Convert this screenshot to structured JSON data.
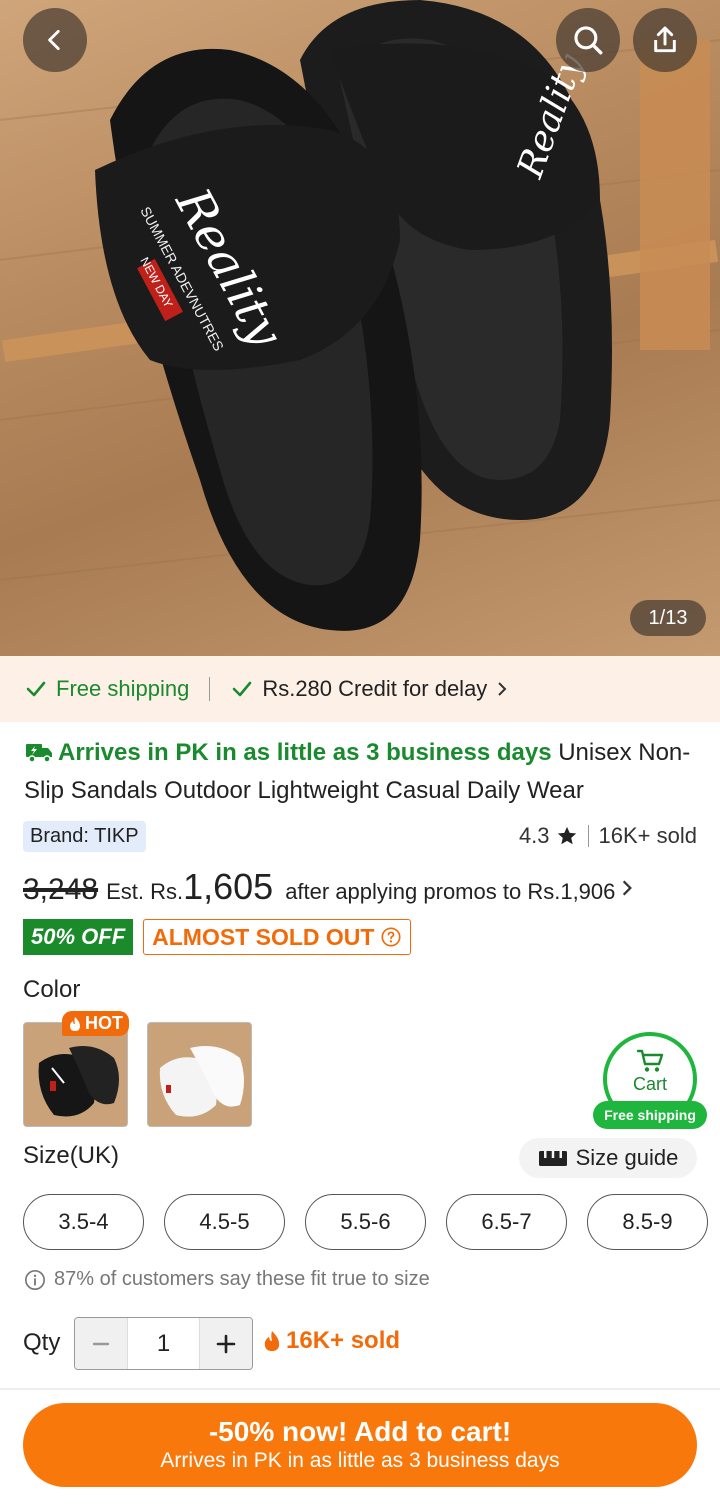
{
  "hero": {
    "counter": "1/13",
    "product_print": {
      "logo": "Reality",
      "line1": "SUMMER ADEVNUTRES",
      "line2": "NEW DAY"
    }
  },
  "shipping_bar": {
    "free_shipping": "Free shipping",
    "credit": "Rs.280 Credit for delay"
  },
  "title": {
    "arrives": "Arrives in PK in as little as 3 business days",
    "name": "Unisex Non-Slip Sandals Outdoor Lightweight Casual Daily Wear"
  },
  "brand": "Brand: TIKP",
  "rating": {
    "score": "4.3",
    "sold": "16K+ sold"
  },
  "price": {
    "old": "3,248",
    "est_label": "Est. Rs.",
    "current": "1,605",
    "after_text": "after applying promos to ",
    "after_price": "Rs.1,906"
  },
  "badges": {
    "off": "50% OFF",
    "almost": "ALMOST SOLD OUT"
  },
  "color": {
    "label": "Color",
    "hot": "HOT"
  },
  "cart": {
    "label": "Cart",
    "free": "Free shipping"
  },
  "size": {
    "label": "Size(UK)",
    "guide": "Size guide",
    "options": [
      "3.5-4",
      "4.5-5",
      "5.5-6",
      "6.5-7",
      "8.5-9"
    ],
    "fit_note": "87% of customers say these fit true to size"
  },
  "qty": {
    "label": "Qty",
    "value": "1",
    "sold": "16K+ sold"
  },
  "cta": {
    "main": "-50% now! Add to cart!",
    "sub": "Arrives in PK in as little as 3 business days"
  },
  "colors": {
    "green": "#1a8a2e",
    "orange": "#f8780c",
    "cart_green": "#1eb63d"
  }
}
